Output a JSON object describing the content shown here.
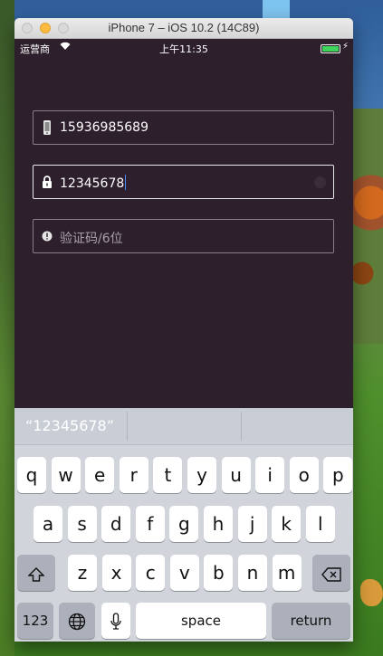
{
  "window": {
    "title": "iPhone 7 – iOS 10.2 (14C89)"
  },
  "status": {
    "carrier": "运营商",
    "time": "上午11:35",
    "battery_level": 1.0
  },
  "form": {
    "phone_value": "15936985689",
    "password_value": "12345678",
    "code_placeholder": "验证码/6位"
  },
  "keyboard": {
    "suggestion": "“12345678”",
    "row1": [
      "q",
      "w",
      "e",
      "r",
      "t",
      "y",
      "u",
      "i",
      "o",
      "p"
    ],
    "row2": [
      "a",
      "s",
      "d",
      "f",
      "g",
      "h",
      "j",
      "k",
      "l"
    ],
    "row3": [
      "z",
      "x",
      "c",
      "v",
      "b",
      "n",
      "m"
    ],
    "numbers_label": "123",
    "space_label": "space",
    "return_label": "return"
  },
  "colors": {
    "app_background": "#2d1f2b",
    "battery": "#3ed35a",
    "caret": "#4a8cff"
  }
}
